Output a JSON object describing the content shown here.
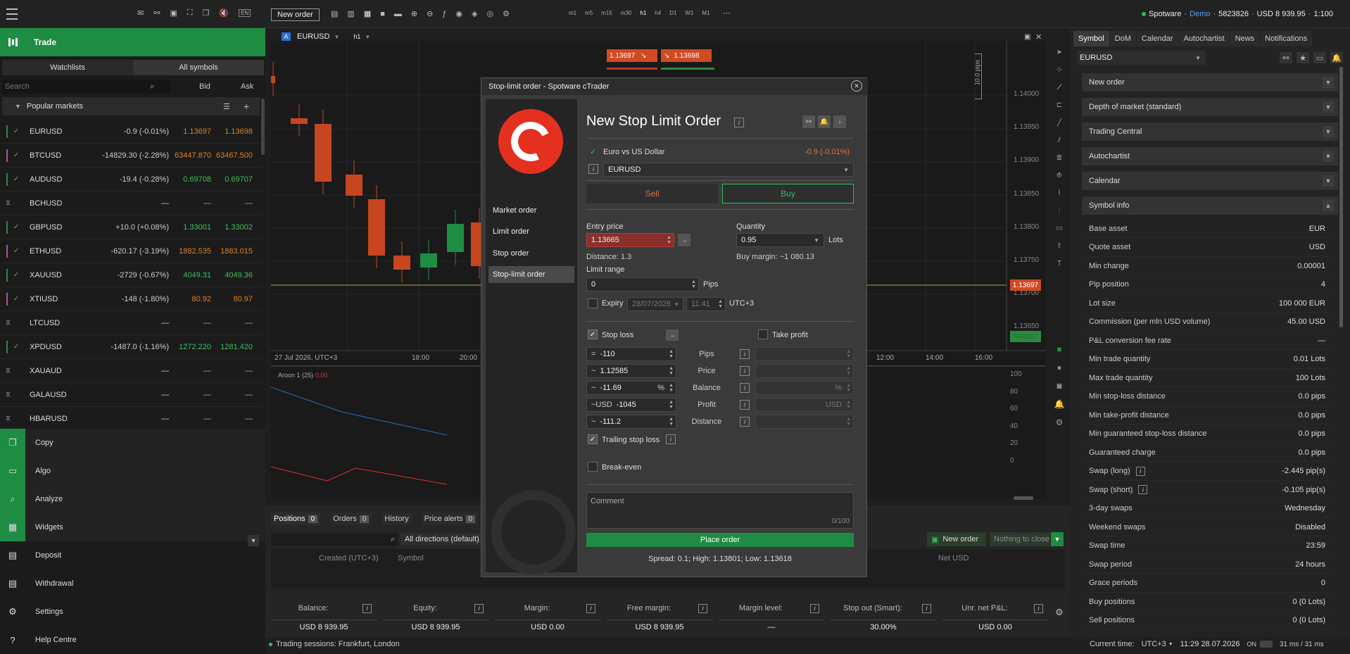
{
  "topbar": {
    "new_order": "New order",
    "timeframes": [
      "m1",
      "m5",
      "m15",
      "m30",
      "h1",
      "h4",
      "D1",
      "W1",
      "M1"
    ],
    "account": "Spotware",
    "account_mode": "Demo",
    "account_id": "5823826",
    "account_balance": "USD 8 939.95",
    "leverage": "1:100"
  },
  "leftpanel": {
    "trade_label": "Trade",
    "tabs": [
      "Watchlists",
      "All symbols"
    ],
    "search_placeholder": "Search",
    "col_bid": "Bid",
    "col_ask": "Ask",
    "section_title": "Popular markets",
    "markets": [
      {
        "symbol": "EURUSD",
        "change": "-0.9 (-0.01%)",
        "bid": "1.13697",
        "ask": "1.13698",
        "state": "up"
      },
      {
        "symbol": "BTCUSD",
        "change": "-14829.30 (-2.28%)",
        "bid": "63447.870",
        "ask": "63467.500",
        "state": "down"
      },
      {
        "symbol": "AUDUSD",
        "change": "-19.4 (-0.28%)",
        "bid": "0.69708",
        "ask": "0.69707",
        "state": "up"
      },
      {
        "symbol": "BCHUSD",
        "change": "—",
        "bid": "—",
        "ask": "—",
        "state": "closed"
      },
      {
        "symbol": "GBPUSD",
        "change": "+10.0 (+0.08%)",
        "bid": "1.33001",
        "ask": "1.33002",
        "state": "up"
      },
      {
        "symbol": "ETHUSD",
        "change": "-620.17 (-3.19%)",
        "bid": "1882.535",
        "ask": "1883.015",
        "state": "down"
      },
      {
        "symbol": "XAUUSD",
        "change": "-2729 (-0.67%)",
        "bid": "4049.31",
        "ask": "4049.36",
        "state": "up"
      },
      {
        "symbol": "XTIUSD",
        "change": "-148 (-1.80%)",
        "bid": "80.92",
        "ask": "80.97",
        "state": "down"
      },
      {
        "symbol": "LTCUSD",
        "change": "—",
        "bid": "—",
        "ask": "—",
        "state": "closed"
      },
      {
        "symbol": "XPDUSD",
        "change": "-1487.0 (-1.16%)",
        "bid": "1272.220",
        "ask": "1281.420",
        "state": "up"
      },
      {
        "symbol": "XAUAUD",
        "change": "—",
        "bid": "—",
        "ask": "—",
        "state": "closed"
      },
      {
        "symbol": "GALAUSD",
        "change": "—",
        "bid": "—",
        "ask": "—",
        "state": "closed"
      },
      {
        "symbol": "HBARUSD",
        "change": "—",
        "bid": "—",
        "ask": "—",
        "state": "closed"
      }
    ],
    "nav": [
      {
        "label": "Copy",
        "icon": "copy-icon"
      },
      {
        "label": "Algo",
        "icon": "algo-icon"
      },
      {
        "label": "Analyze",
        "icon": "analyze-icon"
      },
      {
        "label": "Widgets",
        "icon": "widgets-icon"
      },
      {
        "label": "Deposit",
        "icon": "deposit-icon"
      },
      {
        "label": "Withdrawal",
        "icon": "withdrawal-icon"
      },
      {
        "label": "Settings",
        "icon": "gear-icon"
      },
      {
        "label": "Help Centre",
        "icon": "help-icon"
      }
    ]
  },
  "chart": {
    "symbol": "EURUSD",
    "timeframe": "h1",
    "sell_price": "1.13697",
    "buy_price": "1.13698",
    "pips_label": "10.0 pips",
    "y_labels": [
      "1.14000",
      "1.13950",
      "1.13900",
      "1.13850",
      "1.13800",
      "1.13750",
      "1.13700",
      "1.13650"
    ],
    "current_price": "1.13697",
    "target_label": "TARGET",
    "x_labels": [
      "27 Jul 2026, UTC+3",
      "18:00",
      "20:00",
      "12:00",
      "14:00",
      "16:00"
    ],
    "indicator_label": "Aroon 1 (25)",
    "indicator_value": "0.00",
    "indicator_levels": [
      "100",
      "80",
      "60",
      "40",
      "20",
      "0"
    ]
  },
  "bottom": {
    "tabs": [
      {
        "label": "Positions",
        "count": "0"
      },
      {
        "label": "Orders",
        "count": "0"
      },
      {
        "label": "History",
        "count": ""
      },
      {
        "label": "Price alerts",
        "count": "0"
      }
    ],
    "filter": "All directions (default)",
    "new_order": "New order",
    "nothing_to_close": "Nothing to close",
    "columns": [
      "Created (UTC+3)",
      "Symbol",
      "Net USD"
    ],
    "stats": [
      {
        "label": "Balance:",
        "value": "USD 8 939.95"
      },
      {
        "label": "Equity:",
        "value": "USD 8 939.95"
      },
      {
        "label": "Margin:",
        "value": "USD 0.00"
      },
      {
        "label": "Free margin:",
        "value": "USD 8 939.95"
      },
      {
        "label": "Margin level:",
        "value": "—"
      },
      {
        "label": "Stop out (Smart):",
        "value": "30.00%"
      },
      {
        "label": "Unr. net P&L:",
        "value": "USD 0.00"
      }
    ],
    "sessions": "Trading sessions: Frankfurt, London",
    "current_time_label": "Current time:",
    "timezone": "UTC+3",
    "current_time": "11:29 28.07.2026",
    "on_label": "ON",
    "latency": "31 ms / 31 ms"
  },
  "rightpanel": {
    "tabs": [
      "Symbol",
      "DoM",
      "Calendar",
      "Autochartist",
      "News",
      "Notifications"
    ],
    "symbol_select": "EURUSD",
    "sections": [
      "New order",
      "Depth of market (standard)",
      "Trading Central",
      "Autochartist",
      "Calendar",
      "Symbol info"
    ],
    "info": [
      {
        "k": "Base asset",
        "v": "EUR"
      },
      {
        "k": "Quote asset",
        "v": "USD"
      },
      {
        "k": "Min change",
        "v": "0.00001"
      },
      {
        "k": "Pip position",
        "v": "4"
      },
      {
        "k": "Lot size",
        "v": "100 000 EUR"
      },
      {
        "k": "Commission (per mln USD volume)",
        "v": "45.00 USD"
      },
      {
        "k": "P&L conversion fee rate",
        "v": "—"
      },
      {
        "k": "Min trade quantity",
        "v": "0.01 Lots"
      },
      {
        "k": "Max trade quantity",
        "v": "100 Lots"
      },
      {
        "k": "Min stop-loss distance",
        "v": "0.0 pips"
      },
      {
        "k": "Min take-profit distance",
        "v": "0.0 pips"
      },
      {
        "k": "Min guaranteed stop-loss distance",
        "v": "0.0 pips"
      },
      {
        "k": "Guaranteed charge",
        "v": "0.0 pips"
      },
      {
        "k": "Swap (long)",
        "v": "-2.445 pip(s)"
      },
      {
        "k": "Swap (short)",
        "v": "-0.105 pip(s)"
      },
      {
        "k": "3-day swaps",
        "v": "Wednesday"
      },
      {
        "k": "Weekend swaps",
        "v": "Disabled"
      },
      {
        "k": "Swap time",
        "v": "23:59"
      },
      {
        "k": "Swap period",
        "v": "24 hours"
      },
      {
        "k": "Grace periods",
        "v": "0"
      },
      {
        "k": "Buy positions",
        "v": "0 (0 Lots)"
      },
      {
        "k": "Sell positions",
        "v": "0 (0 Lots)"
      }
    ]
  },
  "dialog": {
    "title": "Stop-limit order - Spotware cTrader",
    "order_types": [
      "Market order",
      "Limit order",
      "Stop order",
      "Stop-limit order"
    ],
    "heading": "New Stop Limit Order",
    "instrument_name": "Euro vs US Dollar",
    "instrument_change": "-0.9 (-0.01%)",
    "symbol": "EURUSD",
    "sell": "Sell",
    "buy": "Buy",
    "entry_price_label": "Entry price",
    "entry_price": "1.13665",
    "quantity_label": "Quantity",
    "quantity": "0.95",
    "lots": "Lots",
    "distance": "Distance: 1.3",
    "buy_margin": "Buy margin: ~1 080.13",
    "limit_range_label": "Limit range",
    "limit_range": "0",
    "pips": "Pips",
    "expiry_label": "Expiry",
    "expiry_date": "28/07/2026",
    "expiry_time": "11:41",
    "expiry_tz": "UTC+3",
    "stop_loss_label": "Stop loss",
    "take_profit_label": "Take profit",
    "sl_rows": [
      {
        "prefix": "=",
        "value": "-110",
        "suffix": "",
        "label": "Pips",
        "tp_suffix": ""
      },
      {
        "prefix": "~",
        "value": "1.12585",
        "suffix": "",
        "label": "Price",
        "tp_suffix": ""
      },
      {
        "prefix": "~",
        "value": "-11.69",
        "suffix": "%",
        "label": "Balance",
        "tp_suffix": "%"
      },
      {
        "prefix": "~USD",
        "value": "-1045",
        "suffix": "",
        "label": "Profit",
        "tp_suffix": "USD"
      },
      {
        "prefix": "~",
        "value": "-111.2",
        "suffix": "",
        "label": "Distance",
        "tp_suffix": ""
      }
    ],
    "trailing_label": "Trailing stop loss",
    "breakeven_label": "Break-even",
    "comment_placeholder": "Comment",
    "comment_count": "0/100",
    "place_order": "Place order",
    "spread": "Spread: 0.1; High: 1.13801; Low: 1.13618"
  }
}
